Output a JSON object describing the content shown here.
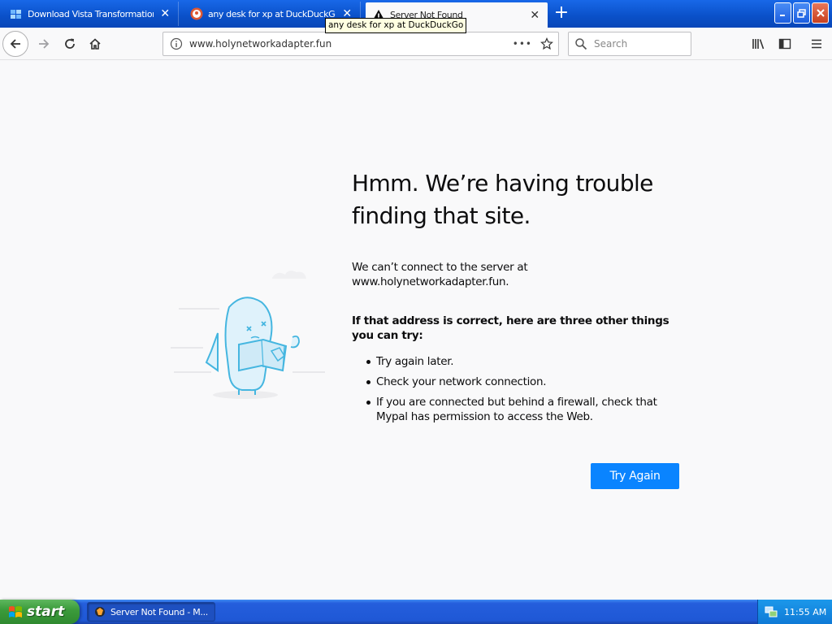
{
  "tabs": [
    {
      "title": "Download Vista Transformation Pa",
      "favicon": "vista-favicon"
    },
    {
      "title": "any desk for xp at DuckDuckGo",
      "favicon": "duckduckgo-favicon"
    },
    {
      "title": "Server Not Found",
      "favicon": "warning-icon",
      "active": true
    }
  ],
  "tooltip": "any desk for xp at DuckDuckGo",
  "newtab_symbol": "+",
  "window_buttons": {
    "minimize": "_",
    "maximize": "❐",
    "close": "✕"
  },
  "urlbar": {
    "url": "www.holynetworkadapter.fun",
    "more": "•••"
  },
  "search": {
    "placeholder": "Search"
  },
  "error": {
    "title": "Hmm. We’re having trouble finding that site.",
    "message": "We can’t connect to the server at www.holynetworkadapter.fun.",
    "suggestions_heading": "If that address is correct, here are three other things you can try:",
    "suggestions": [
      "Try again later.",
      "Check your network connection.",
      "If you are connected but behind a firewall, check that Mypal has permission to access the Web."
    ],
    "button": "Try Again"
  },
  "taskbar": {
    "start_label": "start",
    "window_item": "Server Not Found - M...",
    "clock": "11:55 AM"
  },
  "colors": {
    "accent": "#0a84ff",
    "taskbar": "#245edc",
    "start": "#3c9c3c"
  }
}
